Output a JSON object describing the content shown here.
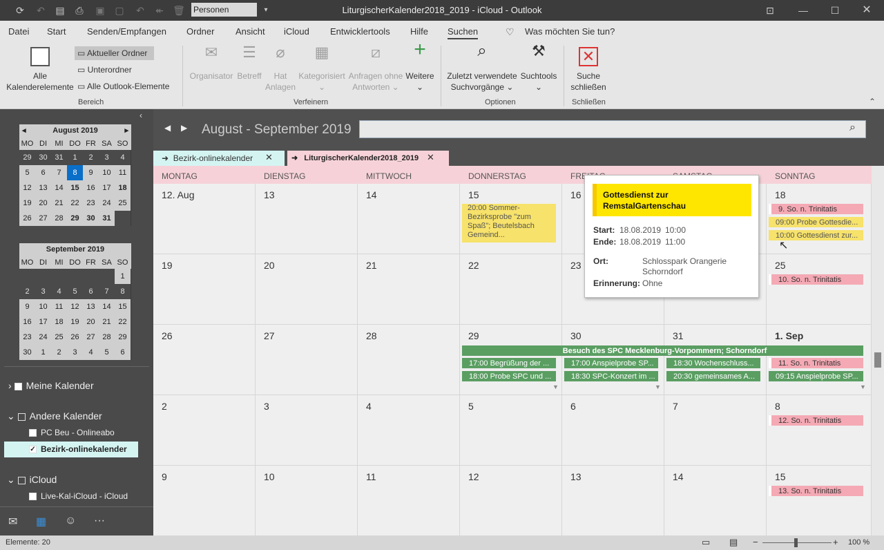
{
  "titlebar": {
    "title": "LiturgischerKalender2018_2019 - iCloud  -  Outlook",
    "search_people": "Personen suchen"
  },
  "menu": [
    "Datei",
    "Start",
    "Senden/Empfangen",
    "Ordner",
    "Ansicht",
    "iCloud",
    "Entwicklertools",
    "Hilfe",
    "Suchen"
  ],
  "tell_me": "Was möchten Sie tun?",
  "ribbon": {
    "alle_1": "Alle",
    "alle_2": "Kalenderelemente",
    "aktueller": "Aktueller Ordner",
    "unterordner": "Unterordner",
    "alle_outlook": "Alle Outlook-Elemente",
    "organisator": "Organisator",
    "betreff": "Betreff",
    "hat_1": "Hat",
    "hat_2": "Anlagen",
    "kategorisiert": "Kategorisiert",
    "anfragen_1": "Anfragen ohne",
    "anfragen_2": "Antworten",
    "weitere": "Weitere",
    "zuletzt_1": "Zuletzt verwendete",
    "zuletzt_2": "Suchvorgänge",
    "suchtools": "Suchtools",
    "suche_1": "Suche",
    "suche_2": "schließen",
    "grp_bereich": "Bereich",
    "grp_verfeinern": "Verfeinern",
    "grp_optionen": "Optionen",
    "grp_schliessen": "Schließen"
  },
  "minical": {
    "aug_title": "August 2019",
    "sep_title": "September 2019",
    "weekdays": [
      "MO",
      "DI",
      "MI",
      "DO",
      "FR",
      "SA",
      "SO"
    ],
    "aug": [
      "29",
      "30",
      "31",
      "1",
      "2",
      "3",
      "4",
      "5",
      "6",
      "7",
      "8",
      "9",
      "10",
      "11",
      "12",
      "13",
      "14",
      "15",
      "16",
      "17",
      "18",
      "19",
      "20",
      "21",
      "22",
      "23",
      "24",
      "25",
      "26",
      "27",
      "28",
      "29",
      "30",
      "31",
      ""
    ],
    "sep": [
      "",
      "",
      "",
      "",
      "",
      "",
      "1",
      "2",
      "3",
      "4",
      "5",
      "6",
      "7",
      "8",
      "9",
      "10",
      "11",
      "12",
      "13",
      "14",
      "15",
      "16",
      "17",
      "18",
      "19",
      "20",
      "21",
      "22",
      "23",
      "24",
      "25",
      "26",
      "27",
      "28",
      "29",
      "30",
      "1",
      "2",
      "3",
      "4",
      "5",
      "6"
    ]
  },
  "folders": {
    "meine": "Meine Kalender",
    "andere": "Andere Kalender",
    "pcbeu": "PC Beu - Onlineabo",
    "bezirk": "Bezirk-onlinekalender",
    "icloud": "iCloud",
    "livekal": "Live-Kal-iCloud - iCloud"
  },
  "calendar": {
    "range": "August - September 2019",
    "tab1": "Bezirk-onlinekalender",
    "tab2": "LiturgischerKalender2018_2019",
    "days": [
      "MONTAG",
      "DIENSTAG",
      "MITTWOCH",
      "DONNERSTAG",
      "FREITAG",
      "SAMSTAG",
      "SONNTAG"
    ],
    "weeks": [
      [
        "12. Aug",
        "13",
        "14",
        "15",
        "16",
        "17",
        "18"
      ],
      [
        "19",
        "20",
        "21",
        "22",
        "23",
        "24",
        "25"
      ],
      [
        "26",
        "27",
        "28",
        "29",
        "30",
        "31",
        "1. Sep"
      ],
      [
        "2",
        "3",
        "4",
        "5",
        "6",
        "7",
        "8"
      ],
      [
        "9",
        "10",
        "11",
        "12",
        "13",
        "14",
        "15"
      ]
    ],
    "events": {
      "e1": "20:00 Sommer-Bezirksprobe \"zum Spaß\"; Beutelsbach Gemeind...",
      "e2": "9. So. n. Trinitatis",
      "e3": "09:00 Probe Gottesdie...",
      "e4": "10:00 Gottesdienst zur...",
      "e5": "10. So. n. Trinitatis",
      "e6": "Besuch des SPC Mecklenburg-Vorpommern; Schorndorf",
      "e7": "17:00 Begrüßung der ...",
      "e8": "18:00 Probe SPC und ...",
      "e9": "17:00 Anspielprobe SP...",
      "e10": "18:30 SPC-Konzert im ...",
      "e11": "18:30 Wochenschluss...",
      "e12": "20:30 gemeinsames A...",
      "e13": "11. So. n. Trinitatis",
      "e14": "09:15 Anspielprobe SP...",
      "e15": "12. So. n. Trinitatis",
      "e16": "13. So. n. Trinitatis"
    }
  },
  "popup": {
    "title": "Gottesdienst zur RemstalGartenschau",
    "start_l": "Start:",
    "start_d": "18.08.2019",
    "start_t": "10:00",
    "ende_l": "Ende:",
    "ende_d": "18.08.2019",
    "ende_t": "11:00",
    "ort_l": "Ort:",
    "ort_1": "Schlosspark Orangerie",
    "ort_2": "Schorndorf",
    "erin_l": "Erinnerung:",
    "erin_v": "Ohne"
  },
  "status": {
    "elemente": "Elemente: 20",
    "zoom": "100 %"
  }
}
